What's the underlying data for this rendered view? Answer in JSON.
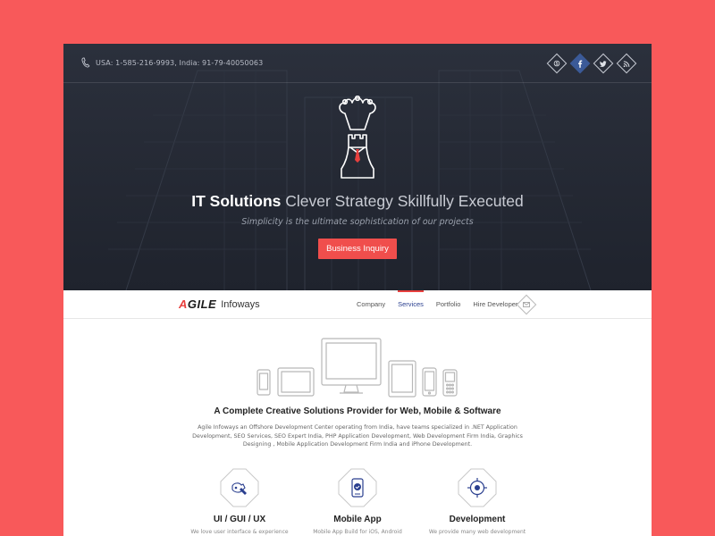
{
  "topbar": {
    "phone_text": "USA: 1-585-216-9993, India: 91-79-40050063",
    "socials": [
      {
        "name": "skype-icon"
      },
      {
        "name": "facebook-icon"
      },
      {
        "name": "twitter-icon"
      },
      {
        "name": "rss-icon"
      }
    ]
  },
  "hero": {
    "headline_bold": "IT Solutions",
    "headline_light": "Clever Strategy Skillfully Executed",
    "tagline": "Simplicity is the ultimate sophistication of our projects",
    "cta_label": "Business Inquiry"
  },
  "nav": {
    "brand_prefix": "A",
    "brand_rest": "GILE",
    "brand_suffix": "Infoways",
    "items": [
      {
        "label": "Company"
      },
      {
        "label": "Services"
      },
      {
        "label": "Portfolio"
      },
      {
        "label": "Hire Developer"
      }
    ],
    "active_item": "Services"
  },
  "content": {
    "title": "A Complete Creative Solutions Provider for Web, Mobile & Software",
    "description": "Agile Infoways an Offshore Development Center operating from India, have teams specialized in .NET Application Development, SEO Services, SEO Expert India, PHP Application Development, Web Development Firm India, Graphics Designing , Mobile Application Development Firm India and iPhone Development."
  },
  "services": [
    {
      "title": "UI / GUI / UX",
      "subtitle": "We love user interface & experience",
      "icon": "pen-tool-icon"
    },
    {
      "title": "Mobile App",
      "subtitle": "Mobile App Build for iOS, Android",
      "icon": "mobile-app-icon"
    },
    {
      "title": "Development",
      "subtitle": "We provide many web development",
      "icon": "development-icon"
    }
  ],
  "colors": {
    "page_background": "#f8595a",
    "hero_background": "#262b37",
    "accent_red": "#f04e4c",
    "facebook_blue": "#3b5a98",
    "active_nav": "#2a3f8f"
  }
}
